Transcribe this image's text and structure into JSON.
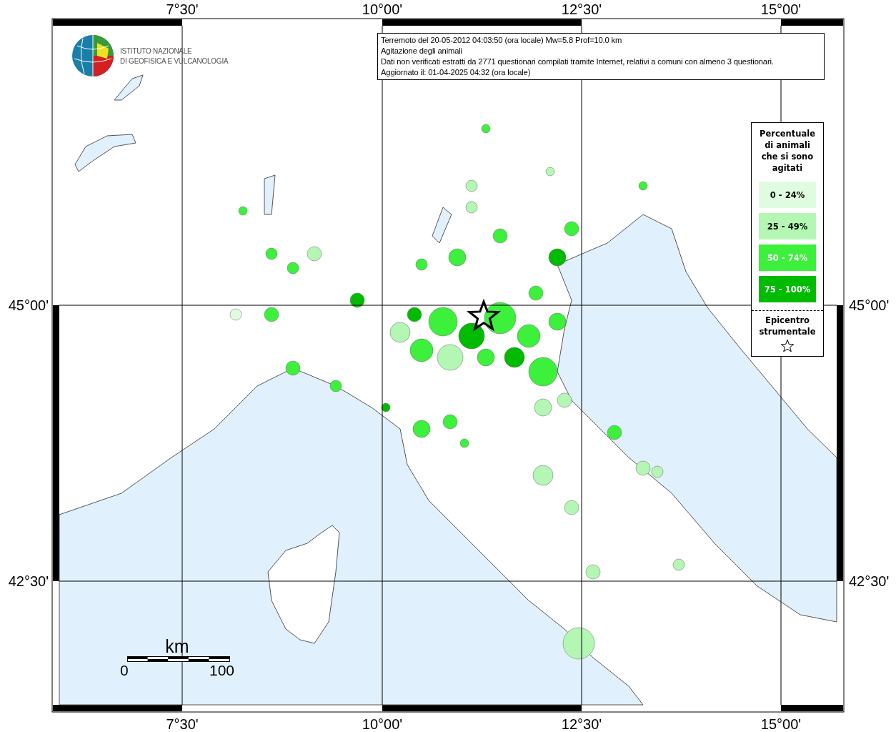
{
  "logo": {
    "lines": [
      "ISTITUTO NAZIONALE",
      "DI GEOFISICA E VULCANOLOGIA"
    ]
  },
  "info": {
    "lines": [
      "Terremoto del 20-05-2012 04:03:50 (ora locale) Mw=5.8 Prof=10.0 km",
      "Agitazione degli animali",
      "Dati non verificati estratti da 2771 questionari compilati tramite Internet, relativi a comuni con almeno 3 questionari.",
      "Aggiornato il: 01-04-2025 04:32 (ora locale)"
    ]
  },
  "legend": {
    "title": "Percentuale di animali che si sono agitati",
    "items": [
      {
        "label": "0 - 24%",
        "color": "#e0fce0"
      },
      {
        "label": "25 - 49%",
        "color": "#b4f7b4"
      },
      {
        "label": "50 - 74%",
        "color": "#3cf03c"
      },
      {
        "label": "75 - 100%",
        "color": "#00bb00"
      }
    ],
    "epicentre": "Epicentro strumentale"
  },
  "axes": {
    "top_ticks": [
      "7°30'",
      "10°00'",
      "12°30'",
      "15°00'"
    ],
    "bottom_ticks": [
      "7°30'",
      "10°00'",
      "12°30'",
      "15°00'"
    ],
    "left_ticks": [
      "45°00'",
      "42°30'"
    ],
    "right_ticks": [
      "45°00'",
      "42°30'"
    ]
  },
  "scale_bar": {
    "unit": "km",
    "labels": [
      "0",
      "100"
    ]
  }
}
